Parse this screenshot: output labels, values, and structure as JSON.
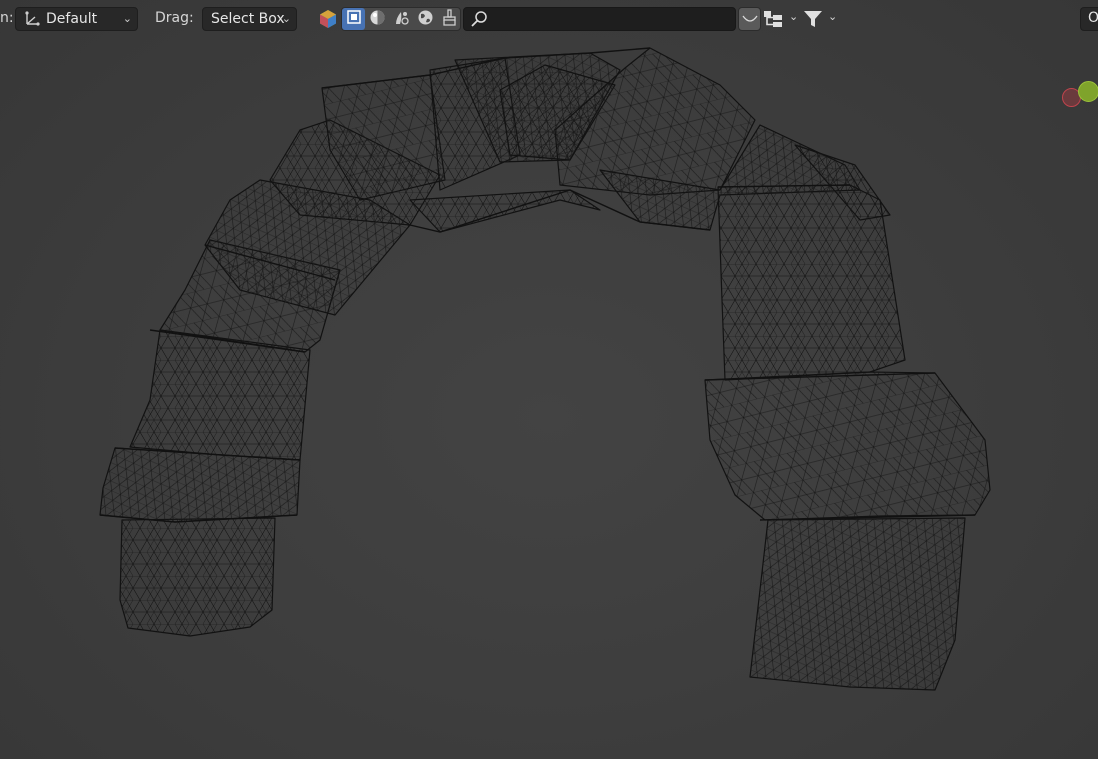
{
  "header": {
    "transform_label": "n:",
    "transform_value": "Default",
    "drag_label": "Drag:",
    "drag_value": "Select Box",
    "search": {
      "value": "",
      "placeholder": ""
    },
    "right_cut_label": "O"
  },
  "icons": {
    "color_filter": "color-filter-icon",
    "select_object": "select-object-icon",
    "shading_solid": "shading-icon",
    "pivot": "pivot-icon",
    "global": "globe-icon",
    "brush": "brush-icon",
    "search": "search-icon",
    "proportional": "proportional-curve-icon",
    "hierarchy": "hierarchy-icon",
    "filter": "filter-icon"
  },
  "colors": {
    "active_button": "#4772b3",
    "gizmo_x": "#c0444d",
    "gizmo_y": "#7fa32b"
  }
}
